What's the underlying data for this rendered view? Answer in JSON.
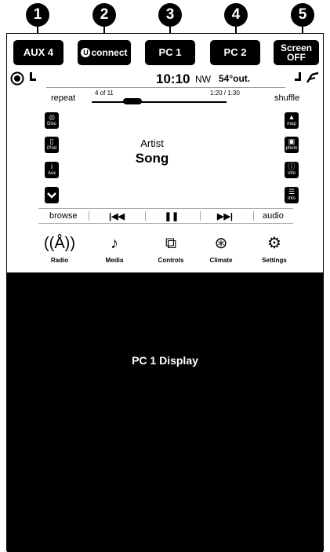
{
  "callouts": [
    "1",
    "2",
    "3",
    "4",
    "5"
  ],
  "top_buttons": {
    "aux": "AUX 4",
    "uconnect": "connect",
    "uconnect_badge": "U",
    "pc1": "PC 1",
    "pc2": "PC 2",
    "screen_off_line1": "Screen",
    "screen_off_line2": "OFF"
  },
  "status": {
    "time": "10:10",
    "heading": "NW",
    "temperature": "54°out."
  },
  "player": {
    "repeat": "repeat",
    "shuffle": "shuffle",
    "track_count": "4 of 11",
    "elapsed_total": "1:20 / 1:30",
    "progress": 0.3,
    "artist": "Artist",
    "song": "Song"
  },
  "left_icons": [
    {
      "label": "Disc",
      "icon": "disc-icon"
    },
    {
      "label": "iPod",
      "icon": "ipod-icon"
    },
    {
      "label": "Aux",
      "icon": "aux-icon"
    }
  ],
  "right_icons": [
    {
      "label": "map",
      "icon": "map-icon"
    },
    {
      "label": "photo",
      "icon": "photo-icon"
    },
    {
      "label": "info",
      "icon": "info-icon"
    },
    {
      "label": "trks",
      "icon": "tracks-icon"
    }
  ],
  "transport": {
    "browse": "browse",
    "audio": "audio"
  },
  "bottom_nav": [
    {
      "label": "Radio",
      "icon": "radio-tower-icon"
    },
    {
      "label": "Media",
      "icon": "music-note-icon"
    },
    {
      "label": "Controls",
      "icon": "controls-icon"
    },
    {
      "label": "Climate",
      "icon": "climate-icon"
    },
    {
      "label": "Settings",
      "icon": "gears-icon"
    }
  ],
  "pc_display": "PC 1 Display"
}
